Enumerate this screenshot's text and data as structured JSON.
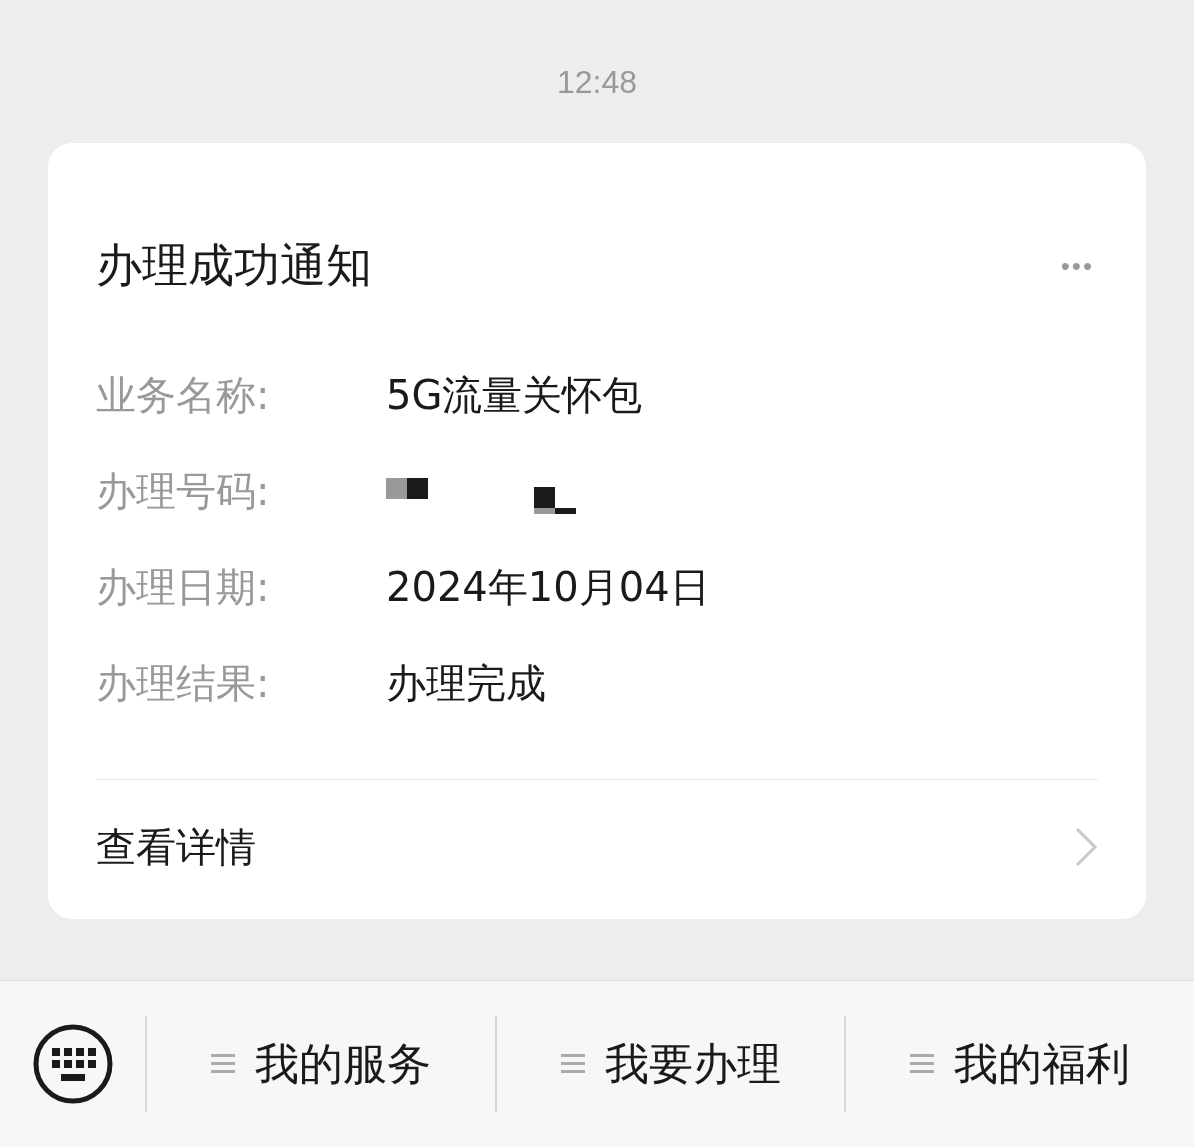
{
  "time": "12:48",
  "card": {
    "title": "办理成功通知",
    "more": "•••",
    "rows": [
      {
        "label": "业务名称:",
        "kind": "text",
        "value": "5G流量关怀包"
      },
      {
        "label": "办理号码:",
        "kind": "redacted"
      },
      {
        "label": "办理日期:",
        "kind": "text",
        "value": "2024年10月04日"
      },
      {
        "label": "办理结果:",
        "kind": "text",
        "value": "办理完成"
      }
    ],
    "link": "查看详情"
  },
  "menu": [
    {
      "label": "我的服务"
    },
    {
      "label": "我要办理"
    },
    {
      "label": "我的福利"
    }
  ]
}
